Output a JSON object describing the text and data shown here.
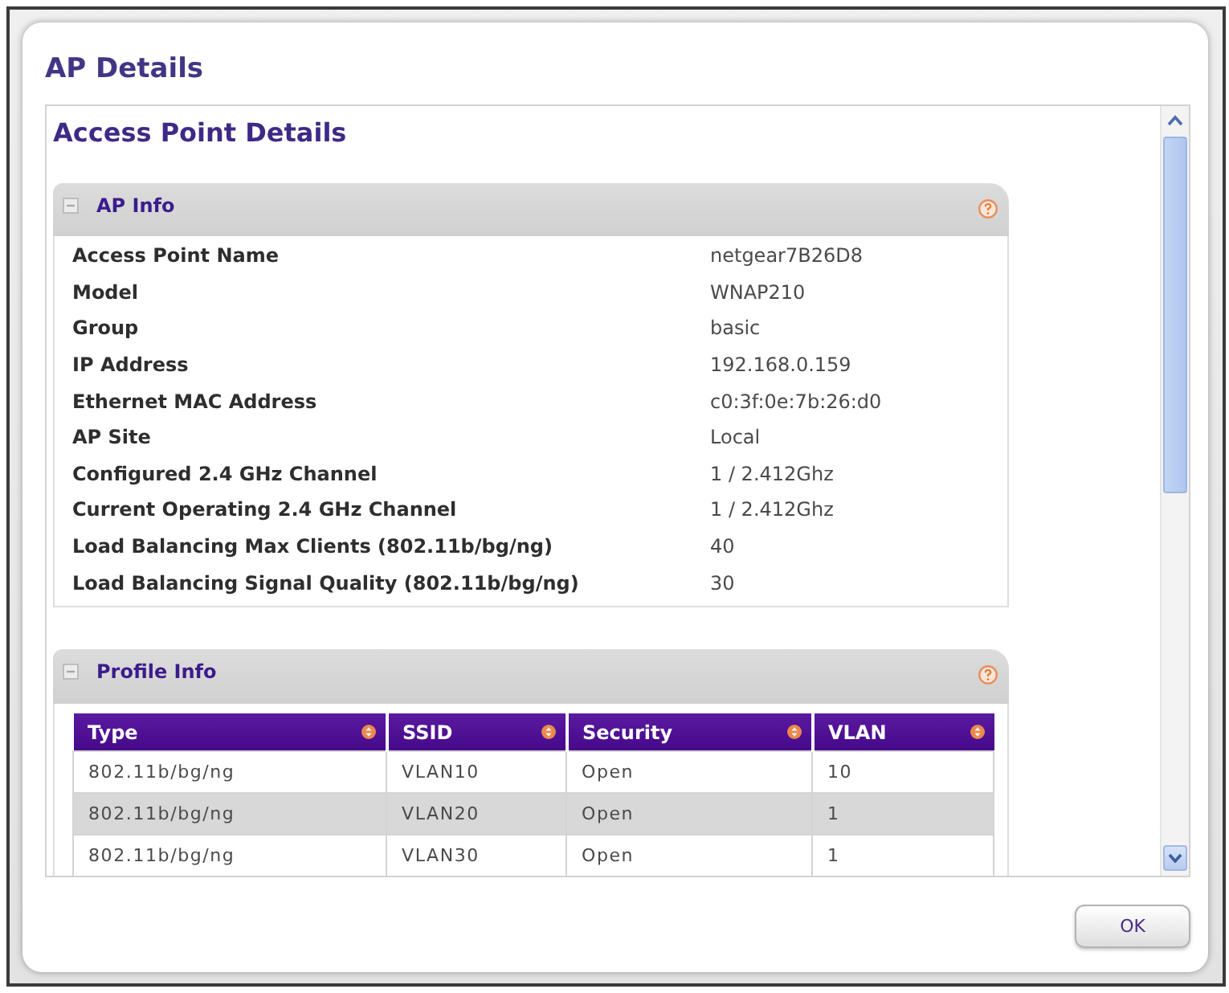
{
  "dialog": {
    "title": "AP Details"
  },
  "section": {
    "heading": "Access Point Details"
  },
  "ap_info": {
    "title": "AP Info",
    "rows": [
      {
        "label": "Access Point Name",
        "value": "netgear7B26D8"
      },
      {
        "label": "Model",
        "value": "WNAP210"
      },
      {
        "label": "Group",
        "value": "basic"
      },
      {
        "label": "IP Address",
        "value": "192.168.0.159"
      },
      {
        "label": "Ethernet MAC Address",
        "value": "c0:3f:0e:7b:26:d0"
      },
      {
        "label": "AP Site",
        "value": "Local"
      },
      {
        "label": "Configured 2.4 GHz Channel",
        "value": "1 / 2.412Ghz"
      },
      {
        "label": "Current Operating 2.4 GHz Channel",
        "value": "1 / 2.412Ghz"
      },
      {
        "label": "Load Balancing Max Clients (802.11b/bg/ng)",
        "value": "40"
      },
      {
        "label": "Load Balancing Signal Quality (802.11b/bg/ng)",
        "value": "30"
      }
    ]
  },
  "profile_info": {
    "title": "Profile Info",
    "columns": [
      "Type",
      "SSID",
      "Security",
      "VLAN"
    ],
    "rows": [
      [
        "802.11b/bg/ng",
        "VLAN10",
        "Open",
        "10"
      ],
      [
        "802.11b/bg/ng",
        "VLAN20",
        "Open",
        "1"
      ],
      [
        "802.11b/bg/ng",
        "VLAN30",
        "Open",
        "1"
      ]
    ]
  },
  "buttons": [
    {
      "label": "OK"
    }
  ]
}
